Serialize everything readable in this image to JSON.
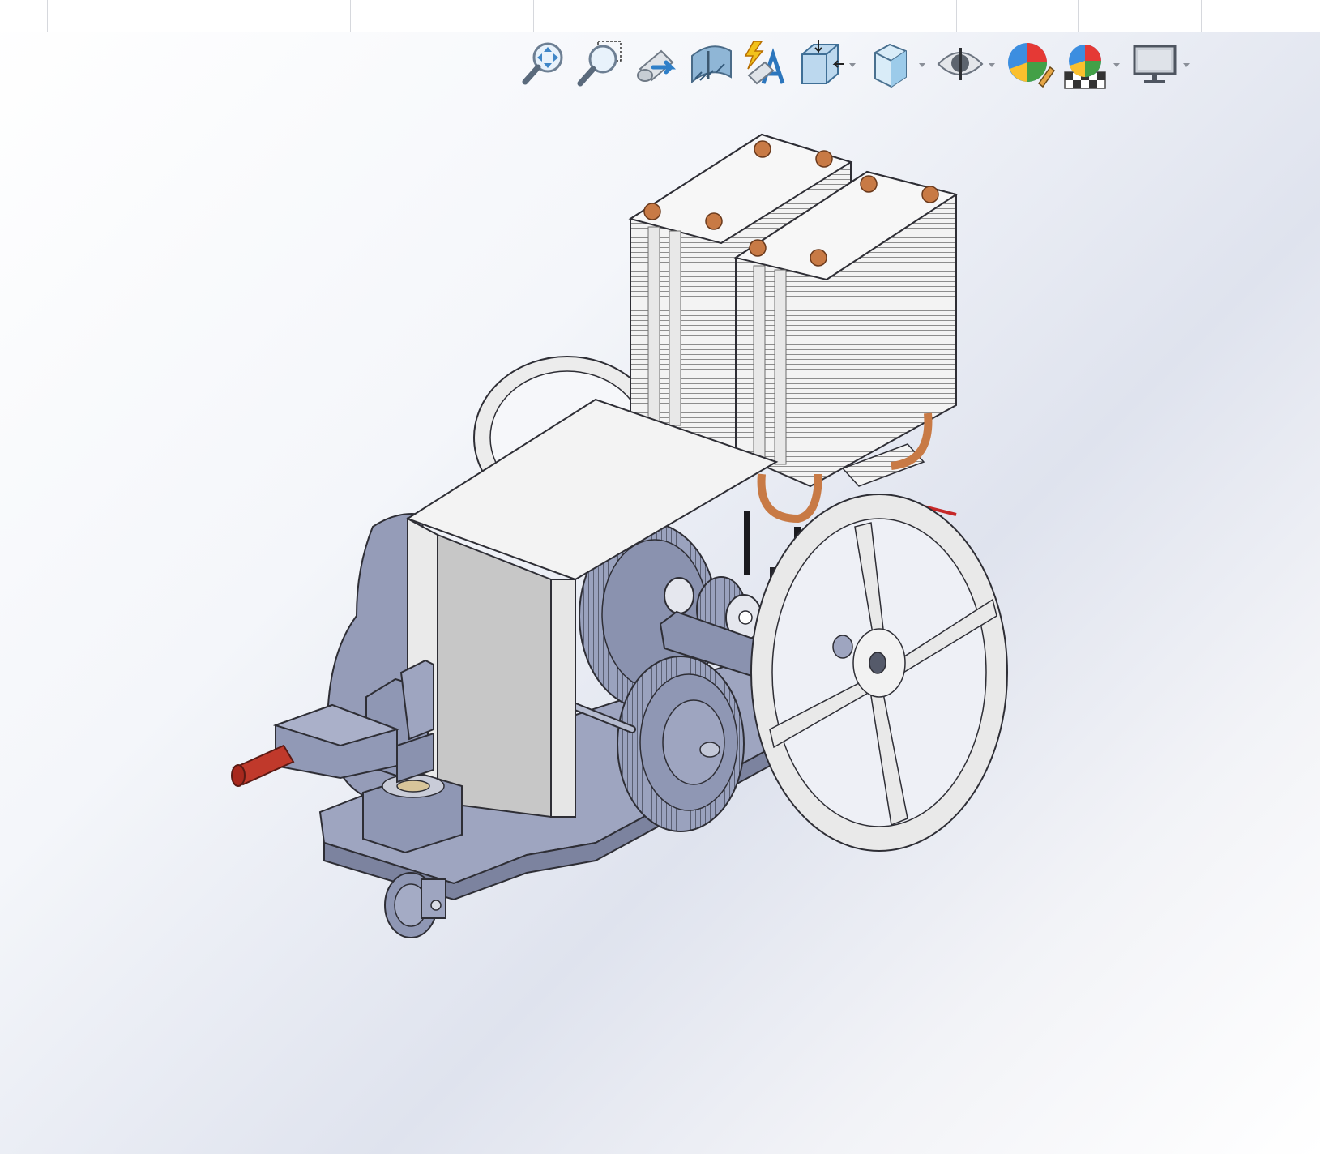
{
  "tabs": [
    "",
    "",
    "",
    "",
    "",
    "",
    ""
  ],
  "toolbar": {
    "items": [
      {
        "name": "zoom-to-fit-icon"
      },
      {
        "name": "zoom-to-area-icon"
      },
      {
        "name": "previous-view-icon"
      },
      {
        "name": "section-view-icon"
      },
      {
        "name": "dynamic-annotation-views-icon"
      },
      {
        "name": "view-orientation-icon",
        "dropdown": true
      },
      {
        "name": "display-style-icon",
        "dropdown": true
      },
      {
        "name": "hide-show-items-icon",
        "dropdown": true
      },
      {
        "name": "edit-appearance-icon"
      },
      {
        "name": "apply-scene-icon",
        "dropdown": true
      },
      {
        "name": "view-settings-icon",
        "dropdown": true
      }
    ]
  },
  "colors": {
    "base_plate": "#9ea5c0",
    "gear": "#8f97b4",
    "heatsink": "#f0f0f0",
    "copper": "#c87a45",
    "handle": "#c0392b",
    "wheel": "#e9e9e9",
    "outline": "#2e2e35"
  }
}
